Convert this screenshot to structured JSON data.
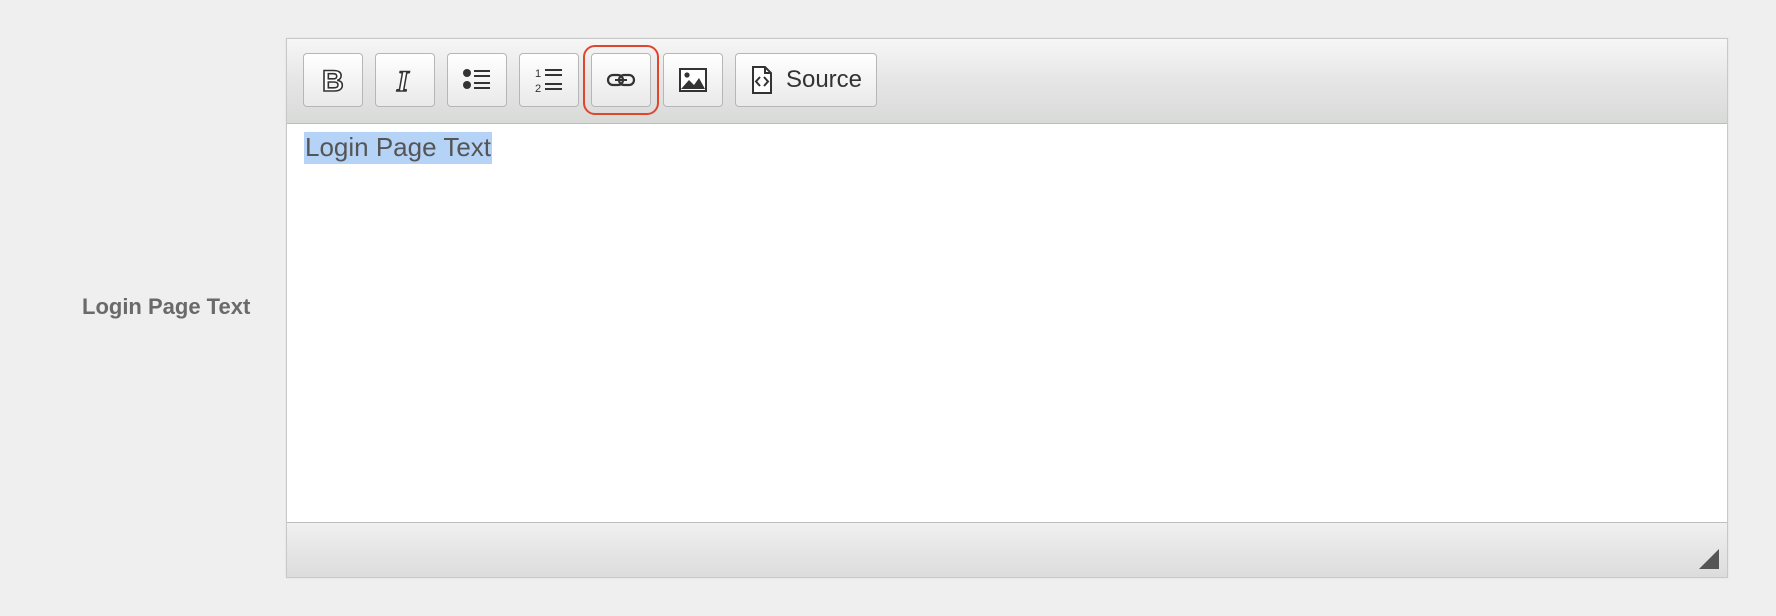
{
  "form": {
    "field_label": "Login Page Text"
  },
  "toolbar": {
    "buttons": [
      {
        "name": "bold",
        "icon": "bold-icon",
        "title": "Bold"
      },
      {
        "name": "italic",
        "icon": "italic-icon",
        "title": "Italic"
      },
      {
        "name": "bulleted-list",
        "icon": "bulleted-list-icon",
        "title": "Bulleted List"
      },
      {
        "name": "numbered-list",
        "icon": "numbered-list-icon",
        "title": "Numbered List"
      },
      {
        "name": "link",
        "icon": "link-icon",
        "title": "Link",
        "highlighted": true
      },
      {
        "name": "image",
        "icon": "image-icon",
        "title": "Image"
      },
      {
        "name": "source",
        "icon": "source-icon",
        "label": "Source"
      }
    ],
    "source_label": "Source"
  },
  "editor": {
    "content_text": "Login Page Text",
    "selection_color": "#b5d3f6"
  },
  "colors": {
    "highlight_outline": "#e0462b",
    "label_text": "#6a6a6a",
    "page_background": "#efefef"
  }
}
